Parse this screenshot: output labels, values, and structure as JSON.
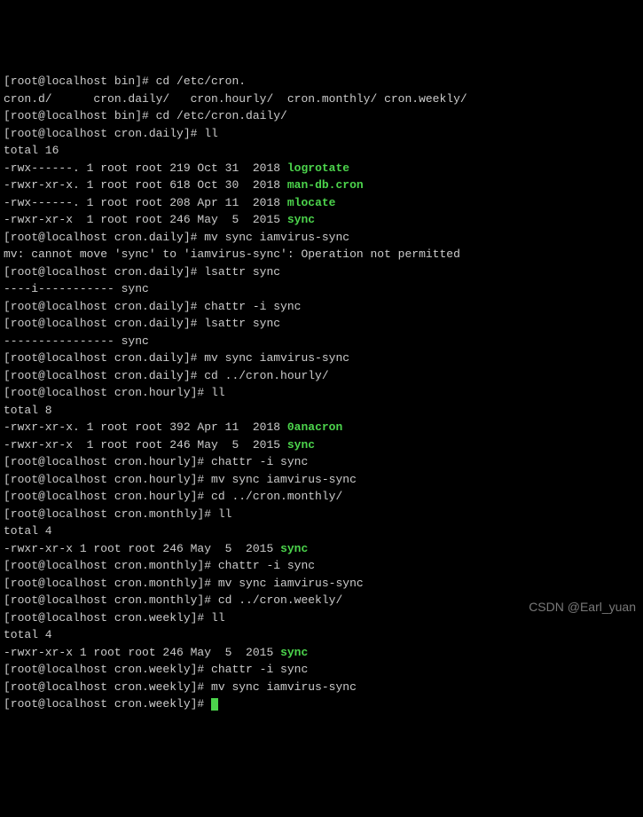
{
  "lines": [
    {
      "segs": [
        {
          "t": "[root@localhost bin]# cd /etc/cron."
        }
      ]
    },
    {
      "segs": [
        {
          "t": "cron.d/      cron.daily/   cron.hourly/  cron.monthly/ cron.weekly/"
        }
      ]
    },
    {
      "segs": [
        {
          "t": "[root@localhost bin]# cd /etc/cron.daily/"
        }
      ]
    },
    {
      "segs": [
        {
          "t": "[root@localhost cron.daily]# ll"
        }
      ]
    },
    {
      "segs": [
        {
          "t": "total 16"
        }
      ]
    },
    {
      "segs": [
        {
          "t": "-rwx------. 1 root root 219 Oct 31  2018 "
        },
        {
          "t": "logrotate",
          "c": "green"
        }
      ]
    },
    {
      "segs": [
        {
          "t": "-rwxr-xr-x. 1 root root 618 Oct 30  2018 "
        },
        {
          "t": "man-db.cron",
          "c": "green"
        }
      ]
    },
    {
      "segs": [
        {
          "t": "-rwx------. 1 root root 208 Apr 11  2018 "
        },
        {
          "t": "mlocate",
          "c": "green"
        }
      ]
    },
    {
      "segs": [
        {
          "t": "-rwxr-xr-x  1 root root 246 May  5  2015 "
        },
        {
          "t": "sync",
          "c": "green"
        }
      ]
    },
    {
      "segs": [
        {
          "t": "[root@localhost cron.daily]# mv sync iamvirus-sync"
        }
      ]
    },
    {
      "segs": [
        {
          "t": "mv: cannot move 'sync' to 'iamvirus-sync': Operation not permitted"
        }
      ]
    },
    {
      "segs": [
        {
          "t": "[root@localhost cron.daily]# lsattr sync"
        }
      ]
    },
    {
      "segs": [
        {
          "t": "----i----------- sync"
        }
      ]
    },
    {
      "segs": [
        {
          "t": "[root@localhost cron.daily]# chattr -i sync"
        }
      ]
    },
    {
      "segs": [
        {
          "t": "[root@localhost cron.daily]# lsattr sync"
        }
      ]
    },
    {
      "segs": [
        {
          "t": "---------------- sync"
        }
      ]
    },
    {
      "segs": [
        {
          "t": "[root@localhost cron.daily]# mv sync iamvirus-sync"
        }
      ]
    },
    {
      "segs": [
        {
          "t": "[root@localhost cron.daily]# cd ../cron.hourly/"
        }
      ]
    },
    {
      "segs": [
        {
          "t": "[root@localhost cron.hourly]# ll"
        }
      ]
    },
    {
      "segs": [
        {
          "t": "total 8"
        }
      ]
    },
    {
      "segs": [
        {
          "t": "-rwxr-xr-x. 1 root root 392 Apr 11  2018 "
        },
        {
          "t": "0anacron",
          "c": "green"
        }
      ]
    },
    {
      "segs": [
        {
          "t": "-rwxr-xr-x  1 root root 246 May  5  2015 "
        },
        {
          "t": "sync",
          "c": "green"
        }
      ]
    },
    {
      "segs": [
        {
          "t": "[root@localhost cron.hourly]# chattr -i sync"
        }
      ]
    },
    {
      "segs": [
        {
          "t": "[root@localhost cron.hourly]# mv sync iamvirus-sync"
        }
      ]
    },
    {
      "segs": [
        {
          "t": "[root@localhost cron.hourly]# cd ../cron.monthly/"
        }
      ]
    },
    {
      "segs": [
        {
          "t": "[root@localhost cron.monthly]# ll"
        }
      ]
    },
    {
      "segs": [
        {
          "t": "total 4"
        }
      ]
    },
    {
      "segs": [
        {
          "t": "-rwxr-xr-x 1 root root 246 May  5  2015 "
        },
        {
          "t": "sync",
          "c": "green"
        }
      ]
    },
    {
      "segs": [
        {
          "t": "[root@localhost cron.monthly]# chattr -i sync"
        }
      ]
    },
    {
      "segs": [
        {
          "t": "[root@localhost cron.monthly]# mv sync iamvirus-sync"
        }
      ]
    },
    {
      "segs": [
        {
          "t": "[root@localhost cron.monthly]# cd ../cron.weekly/"
        }
      ]
    },
    {
      "segs": [
        {
          "t": "[root@localhost cron.weekly]# ll"
        }
      ]
    },
    {
      "segs": [
        {
          "t": "total 4"
        }
      ]
    },
    {
      "segs": [
        {
          "t": "-rwxr-xr-x 1 root root 246 May  5  2015 "
        },
        {
          "t": "sync",
          "c": "green"
        }
      ]
    },
    {
      "segs": [
        {
          "t": "[root@localhost cron.weekly]# chattr -i sync"
        }
      ]
    },
    {
      "segs": [
        {
          "t": "[root@localhost cron.weekly]# mv sync iamvirus-sync"
        }
      ]
    },
    {
      "segs": [
        {
          "t": "[root@localhost cron.weekly]# "
        }
      ],
      "cursor": true
    }
  ],
  "watermark": "CSDN @Earl_yuan"
}
